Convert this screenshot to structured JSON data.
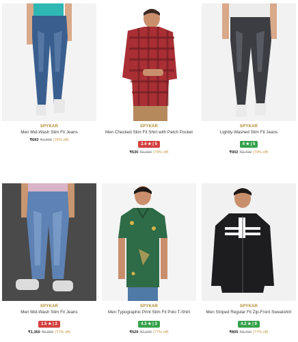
{
  "products": [
    {
      "brand": "SPYKAR",
      "name": "Men Mid-Wash Slim Fit Jeans",
      "rating": "",
      "rating_color": "",
      "price": "₹693",
      "mrp": "₹2,899",
      "discount": "(76% off)",
      "image": "blue-jeans-model-photo"
    },
    {
      "brand": "SPYKAR",
      "name": "Men Checked Slim Fit Shirt with Patch Pocket",
      "rating": "2.4 ★ | 5",
      "rating_color": "#d2403f",
      "price": "₹630",
      "mrp": "₹2,099",
      "discount": "(70% off)",
      "image": "red-checked-shirt-model-photo"
    },
    {
      "brand": "SPYKAR",
      "name": "Lightly-Washed Slim Fit Jeans",
      "rating": "4 ★ | 5",
      "rating_color": "#35a14a",
      "price": "₹902",
      "mrp": "₹3,499",
      "discount": "(74% off)",
      "image": "black-jeans-model-photo"
    },
    {
      "brand": "SPYKAR",
      "name": "Men Mid-Wash Slim Fit Jeans",
      "rating": "1.5 ★ | 2",
      "rating_color": "#d2403f",
      "price": "₹1,360",
      "mrp": "₹5,899",
      "discount": "(77% off)",
      "image": "mid-wash-jeans-model-photo"
    },
    {
      "brand": "SPYKAR",
      "name": "Men Typographic Print Slim Fit Polo T-Shirt",
      "rating": "4.3 ★ | 3",
      "rating_color": "#35a14a",
      "price": "₹529",
      "mrp": "₹2,299",
      "discount": "(77% off)",
      "image": "green-polo-model-photo"
    },
    {
      "brand": "SPYKAR",
      "name": "Men Striped Regular Fit Zip-Front Sweatshirt",
      "rating": "4.2 ★ | 9",
      "rating_color": "#35a14a",
      "price": "₹805",
      "mrp": "₹3,499",
      "discount": "(77% off)",
      "image": "black-sweatshirt-model-photo"
    }
  ]
}
